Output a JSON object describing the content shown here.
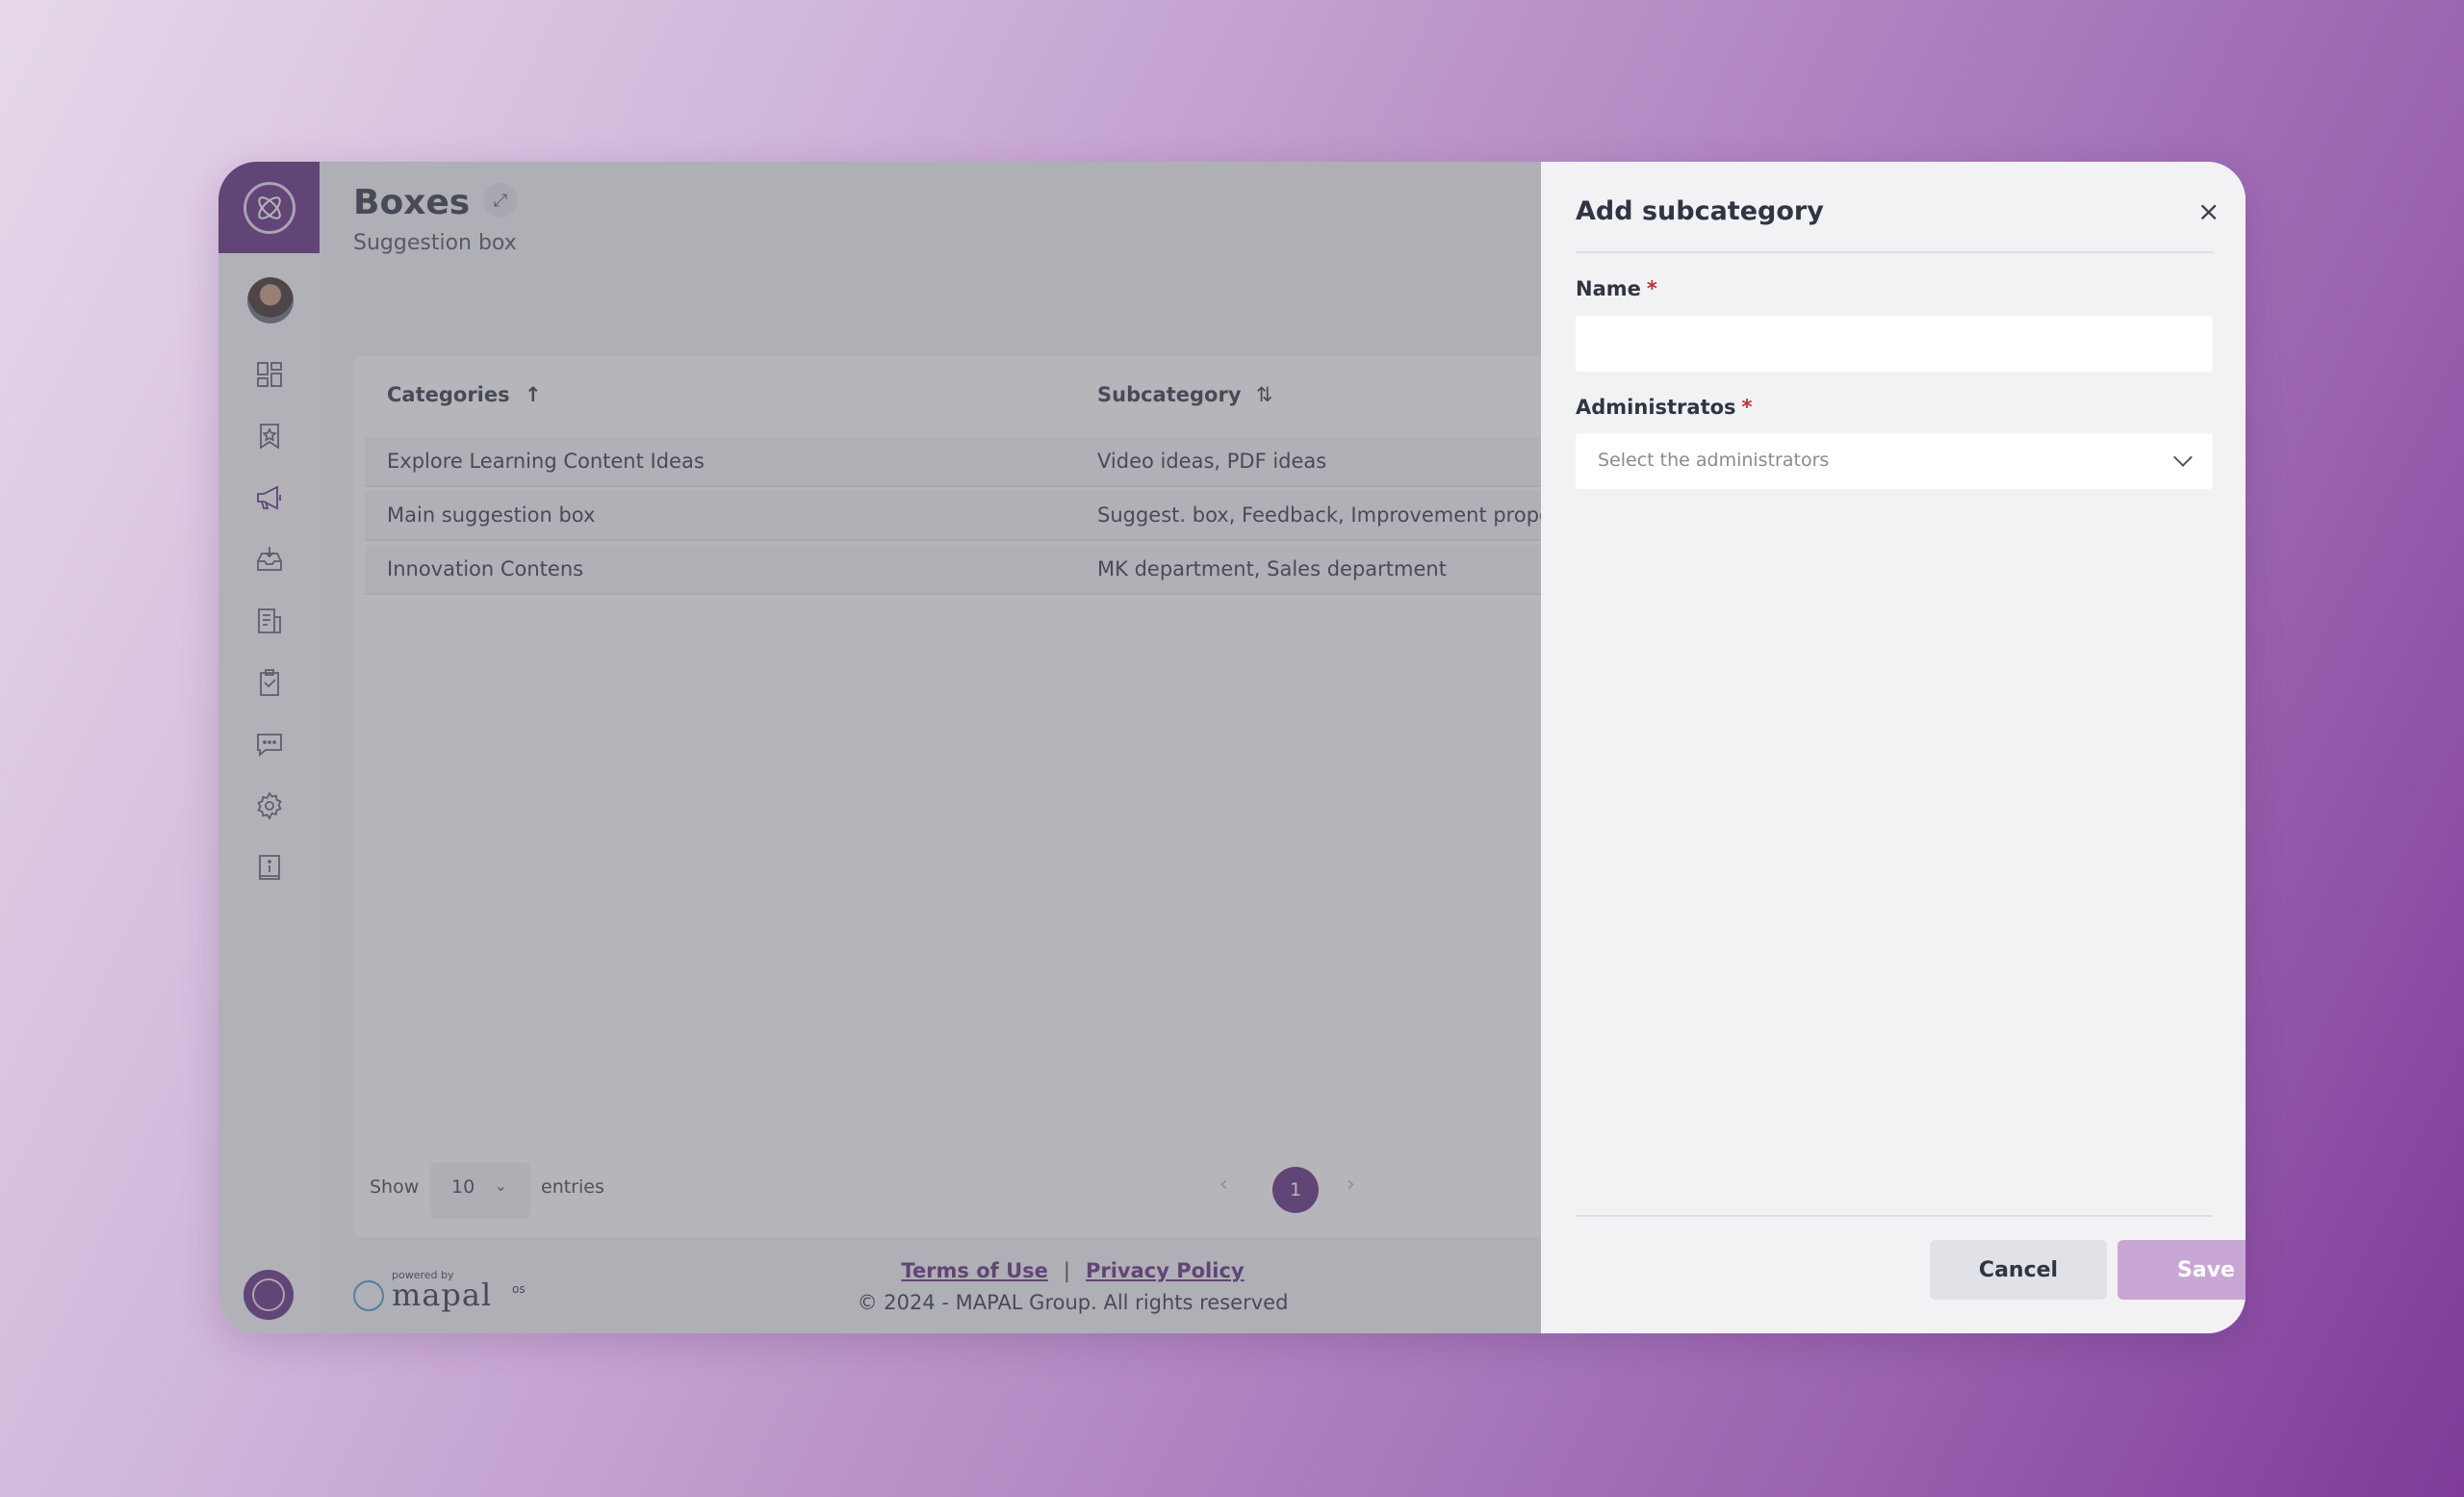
{
  "header": {
    "title": "Boxes",
    "subtitle": "Suggestion box"
  },
  "table": {
    "columns": [
      {
        "label": "Categories",
        "sort_icon": "↑"
      },
      {
        "label": "Subcategory",
        "sort_icon": "⇅"
      }
    ],
    "rows": [
      {
        "category": "Explore Learning Content Ideas",
        "subcategory": "Video ideas, PDF ideas"
      },
      {
        "category": "Main suggestion box",
        "subcategory": "Suggest. box, Feedback, Improvement proposals"
      },
      {
        "category": "Innovation Contens",
        "subcategory": "MK department, Sales department"
      }
    ]
  },
  "pagination": {
    "show_label": "Show",
    "page_size": "10",
    "entries_label": "entries",
    "current_page": "1",
    "prev": "‹",
    "next": "›"
  },
  "footer": {
    "powered_by": "powered by",
    "brand": "mapal",
    "brand_suffix": "os",
    "terms": "Terms of Use",
    "separator": "|",
    "privacy": "Privacy Policy",
    "copyright": "© 2024 - MAPAL Group. All rights reserved"
  },
  "drawer": {
    "title": "Add subcategory",
    "close_icon": "×",
    "name_label": "Name",
    "name_value": "",
    "admins_label": "Administratos",
    "admins_placeholder": "Select the administrators",
    "required_mark": "*",
    "cancel_label": "Cancel",
    "save_label": "Save"
  },
  "sidebar": {
    "icons": [
      "dashboard-icon",
      "bookmark-star-icon",
      "megaphone-icon",
      "inbox-download-icon",
      "document-icon",
      "clipboard-check-icon",
      "chat-icon",
      "gear-icon",
      "info-book-icon"
    ]
  },
  "colors": {
    "brand_purple": "#5e2a7e",
    "save_disabled": "#c9a7d4",
    "required": "#c0303a"
  }
}
